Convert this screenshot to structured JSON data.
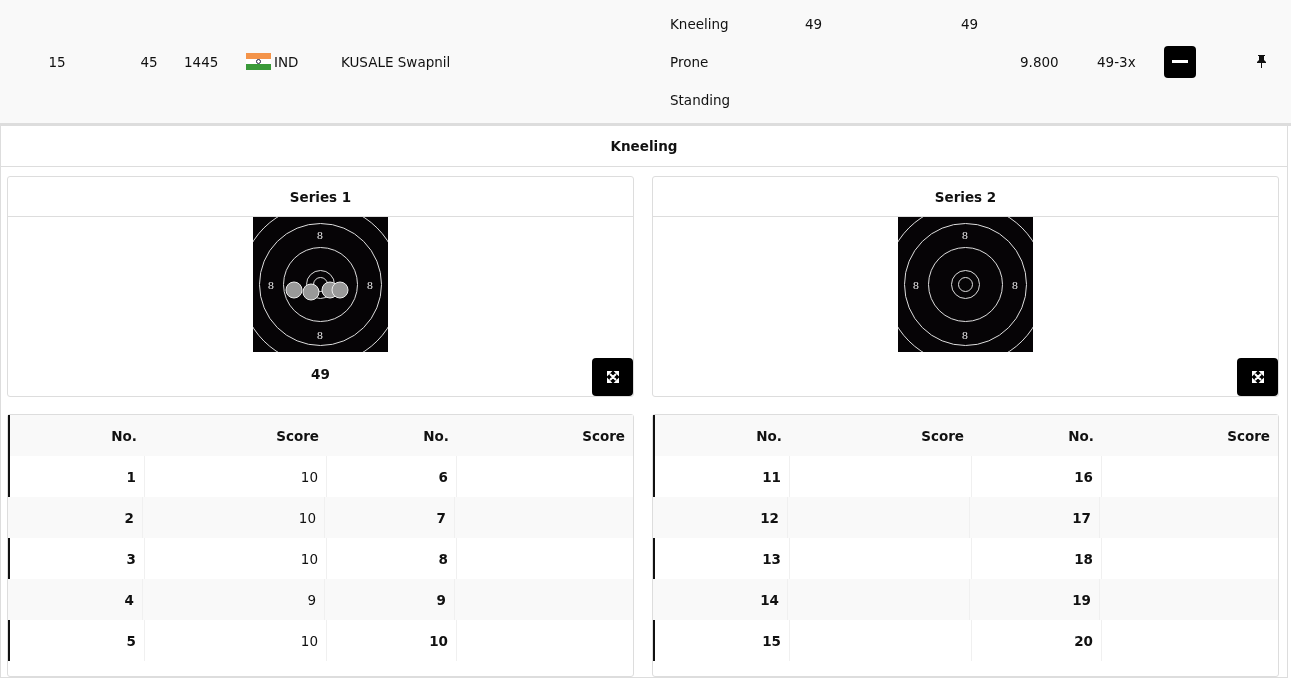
{
  "athlete_row": {
    "rank": "15",
    "bib": "45",
    "value": "1445",
    "country": "IND",
    "name": "KUSALE Swapnil",
    "positions": [
      {
        "label": "Kneeling",
        "score_1": "49",
        "score_2": "49"
      },
      {
        "label": "Prone"
      },
      {
        "label": "Standing"
      }
    ],
    "average": "9.800",
    "total": "49-3x",
    "expanded": true
  },
  "stage": {
    "title": "Kneeling",
    "series": [
      {
        "title": "Series 1",
        "ring_labels": [
          "8",
          "8",
          "8",
          "8"
        ],
        "shots": [
          {
            "kind": "hit"
          },
          {
            "kind": "hit"
          },
          {
            "kind": "hit"
          },
          {
            "kind": "hit"
          }
        ],
        "score": "49",
        "table": {
          "columns": [
            "No.",
            "Score",
            "No.",
            "Score"
          ],
          "rows": [
            {
              "no": "1",
              "score": "10",
              "no_2": "6"
            },
            {
              "no": "2",
              "score": "10",
              "no_2": "7"
            },
            {
              "no": "3",
              "score": "10",
              "no_2": "8"
            },
            {
              "no": "4",
              "score": "9",
              "no_2": "9"
            },
            {
              "no": "5",
              "score": "10",
              "no_2": "10"
            }
          ]
        }
      },
      {
        "title": "Series 2",
        "ring_labels": [
          "8",
          "8",
          "8",
          "8"
        ],
        "table": {
          "columns": [
            "No.",
            "Score",
            "No.",
            "Score"
          ],
          "rows": [
            {
              "no": "11",
              "no_2": "16"
            },
            {
              "no": "12",
              "no_2": "17"
            },
            {
              "no": "13",
              "no_2": "18"
            },
            {
              "no": "14",
              "no_2": "19"
            },
            {
              "no": "15",
              "no_2": "20"
            }
          ]
        }
      }
    ]
  }
}
